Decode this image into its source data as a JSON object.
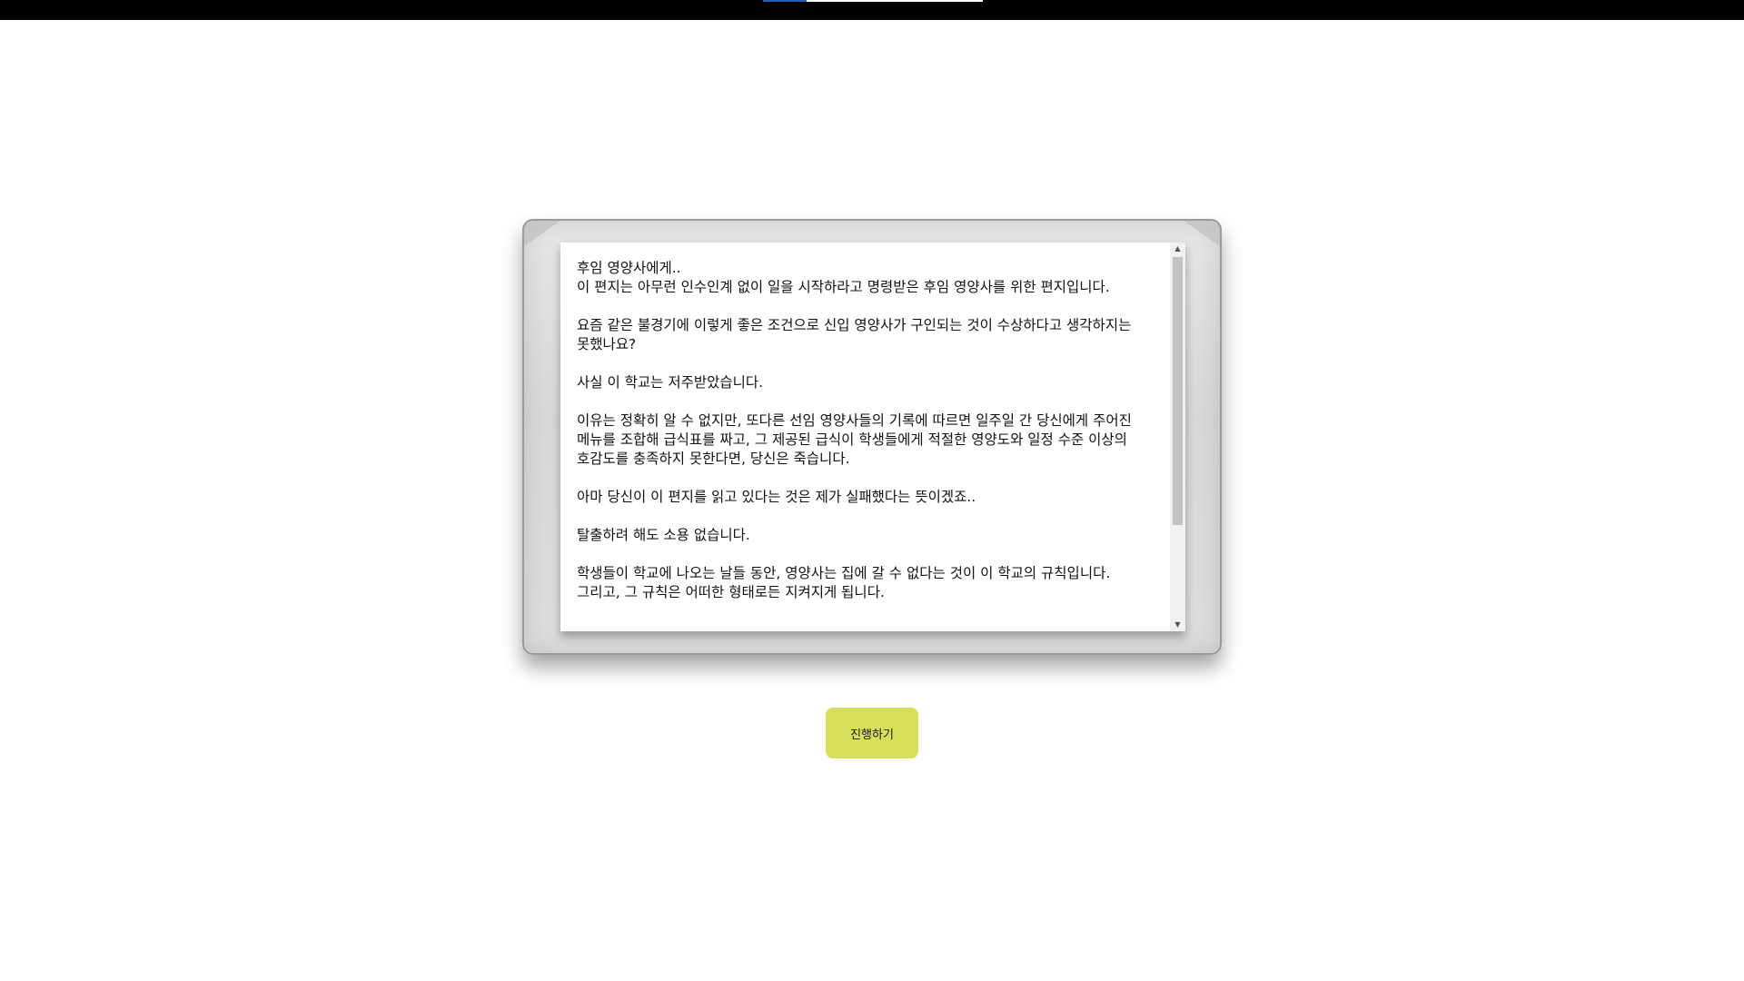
{
  "top_bar": {
    "progress": 0.2
  },
  "letter": {
    "text": "후임 영양사에게..\n이 편지는 아무런 인수인계 없이 일을 시작하라고 명령받은 후임 영양사를 위한 편지입니다.\n\n요즘 같은 불경기에 이렇게 좋은 조건으로 신입 영양사가 구인되는 것이 수상하다고 생각하지는 못했나요?\n\n사실 이 학교는 저주받았습니다.\n\n이유는 정확히 알 수 없지만, 또다른 선임 영양사들의 기록에 따르면 일주일 간 당신에게 주어진 메뉴를 조합해 급식표를 짜고, 그 제공된 급식이 학생들에게 적절한 영양도와 일정 수준 이상의 호감도를 충족하지 못한다면, 당신은 죽습니다.\n\n아마 당신이 이 편지를 읽고 있다는 것은 제가 실패했다는 뜻이겠죠..\n\n탈출하려 해도 소용 없습니다.\n\n학생들이 학교에 나오는 날들 동안, 영양사는 집에 갈 수 없다는 것이 이 학교의 규칙입니다. 그리고, 그 규칙은 어떠한 형태로든 지켜지게 됩니다."
  },
  "scrollbar": {
    "up_arrow": "▲",
    "down_arrow": "▼"
  },
  "actions": {
    "proceed_label": "진행하기",
    "proceed_color": "#d6e05a"
  }
}
